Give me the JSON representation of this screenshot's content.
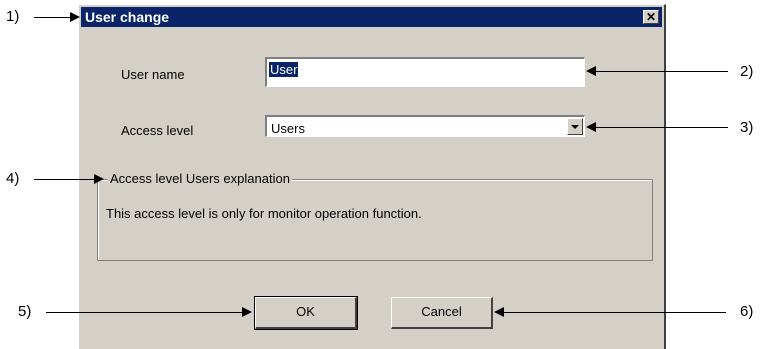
{
  "dialog": {
    "title": "User change",
    "close_symbol": "✕",
    "user_name_label": "User name",
    "user_name_value": "User",
    "access_level_label": "Access level",
    "access_level_value": "Users",
    "group_title": "Access level Users explanation",
    "group_text": "This access level is only for monitor operation function.",
    "ok_label": "OK",
    "cancel_label": "Cancel"
  },
  "callouts": {
    "c1": "1)",
    "c2": "2)",
    "c3": "3)",
    "c4": "4)",
    "c5": "5)",
    "c6": "6)"
  }
}
